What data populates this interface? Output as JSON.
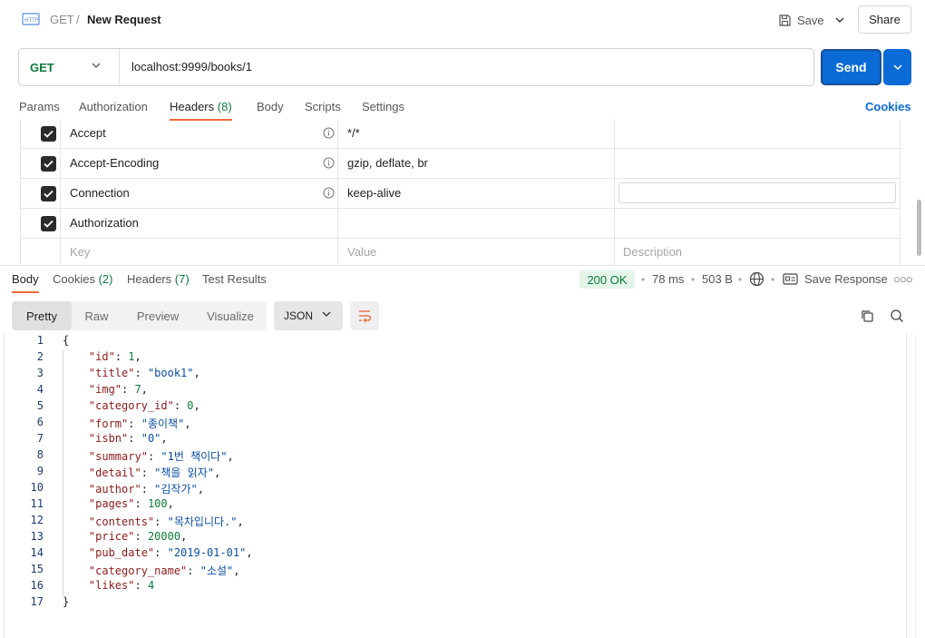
{
  "header": {
    "method": "GET",
    "separator": "/",
    "request_name": "New Request",
    "save_label": "Save",
    "share_label": "Share"
  },
  "request": {
    "method": "GET",
    "url": "localhost:9999/books/1",
    "send_label": "Send",
    "tabs": [
      {
        "label": "Params"
      },
      {
        "label": "Authorization"
      },
      {
        "label": "Headers",
        "count": "(8)"
      },
      {
        "label": "Body"
      },
      {
        "label": "Scripts"
      },
      {
        "label": "Settings"
      }
    ],
    "cookies_label": "Cookies"
  },
  "headers_table": {
    "rows": [
      {
        "key": "Accept",
        "value": "*/*",
        "description": ""
      },
      {
        "key": "Accept-Encoding",
        "value": "gzip, deflate, br",
        "description": ""
      },
      {
        "key": "Connection",
        "value": "keep-alive",
        "description": ""
      },
      {
        "key": "Authorization",
        "value": "",
        "description": ""
      }
    ],
    "placeholder": {
      "key": "Key",
      "value": "Value",
      "description": "Description"
    }
  },
  "response": {
    "tabs": [
      {
        "label": "Body"
      },
      {
        "label": "Cookies",
        "count": "(2)"
      },
      {
        "label": "Headers",
        "count": "(7)"
      },
      {
        "label": "Test Results"
      }
    ],
    "status": "200 OK",
    "time": "78 ms",
    "size": "503 B",
    "save_response_label": "Save Response",
    "view_modes": [
      "Pretty",
      "Raw",
      "Preview",
      "Visualize"
    ],
    "format": "JSON",
    "body_lines": [
      {
        "n": "1",
        "text": "{"
      },
      {
        "n": "2",
        "key": "\"id\"",
        "val": "1",
        "type": "num",
        "comma": ","
      },
      {
        "n": "3",
        "key": "\"title\"",
        "val": "\"book1\"",
        "type": "str",
        "comma": ","
      },
      {
        "n": "4",
        "key": "\"img\"",
        "val": "7",
        "type": "num",
        "comma": ","
      },
      {
        "n": "5",
        "key": "\"category_id\"",
        "val": "0",
        "type": "num",
        "comma": ","
      },
      {
        "n": "6",
        "key": "\"form\"",
        "val": "\"종이책\"",
        "type": "str",
        "comma": ","
      },
      {
        "n": "7",
        "key": "\"isbn\"",
        "val": "\"0\"",
        "type": "str",
        "comma": ","
      },
      {
        "n": "8",
        "key": "\"summary\"",
        "val": "\"1번 책이다\"",
        "type": "str",
        "comma": ","
      },
      {
        "n": "9",
        "key": "\"detail\"",
        "val": "\"책을 읽자\"",
        "type": "str",
        "comma": ","
      },
      {
        "n": "10",
        "key": "\"author\"",
        "val": "\"김작가\"",
        "type": "str",
        "comma": ","
      },
      {
        "n": "11",
        "key": "\"pages\"",
        "val": "100",
        "type": "num",
        "comma": ","
      },
      {
        "n": "12",
        "key": "\"contents\"",
        "val": "\"목차입니다.\"",
        "type": "str",
        "comma": ","
      },
      {
        "n": "13",
        "key": "\"price\"",
        "val": "20000",
        "type": "num",
        "comma": ","
      },
      {
        "n": "14",
        "key": "\"pub_date\"",
        "val": "\"2019-01-01\"",
        "type": "str",
        "comma": ","
      },
      {
        "n": "15",
        "key": "\"category_name\"",
        "val": "\"소설\"",
        "type": "str",
        "comma": ","
      },
      {
        "n": "16",
        "key": "\"likes\"",
        "val": "4",
        "type": "num",
        "comma": ""
      },
      {
        "n": "17",
        "text": "}"
      }
    ]
  },
  "colors": {
    "accent_tab": "#f26b3a",
    "send_button": "#0a6ad6",
    "method_green": "#0c7a3b",
    "status_bg": "#e4f4e8"
  },
  "icons": [
    "http-icon",
    "save-icon",
    "chevron-down-icon",
    "info-icon",
    "checkbox-checked-icon",
    "globe-icon",
    "save-response-icon",
    "more-icon",
    "wrap-lines-icon",
    "copy-icon",
    "search-icon"
  ]
}
